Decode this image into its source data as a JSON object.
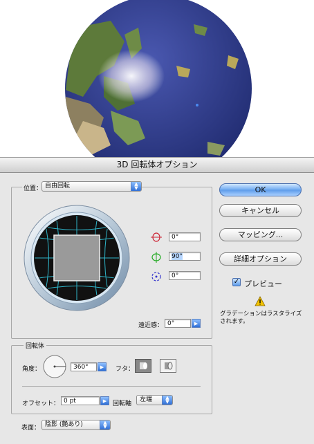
{
  "dialog": {
    "title": "3D 回転体オプション",
    "position": {
      "label": "位置：",
      "value": "自由回転"
    },
    "rotation": {
      "x_value": "0°",
      "y_value": "90°",
      "z_value": "0°"
    },
    "perspective": {
      "label": "遠近感：",
      "value": "0°"
    },
    "revolve": {
      "group_label": "回転体",
      "angle_label": "角度：",
      "angle_value": "360°",
      "cap_label": "フタ：",
      "offset_label": "オフセット：",
      "offset_value": "0 pt",
      "axis_label": "回転軸",
      "axis_value": "左端"
    },
    "surface": {
      "label": "表面：",
      "value": "陰影 (艶あり)"
    },
    "buttons": {
      "ok": "OK",
      "cancel": "キャンセル",
      "mapping": "マッピング...",
      "more_options": "詳細オプション"
    },
    "preview": {
      "label": "プレビュー",
      "checked": true
    },
    "warning": {
      "text": "グラデーションはラスタライズされます。"
    }
  },
  "colors": {
    "globe_ocean": "#2f3f8f",
    "accent_blue": "#3f7fe0",
    "track_cube_face": "#9a9a9a",
    "track_grid": "#2fb5c9"
  }
}
